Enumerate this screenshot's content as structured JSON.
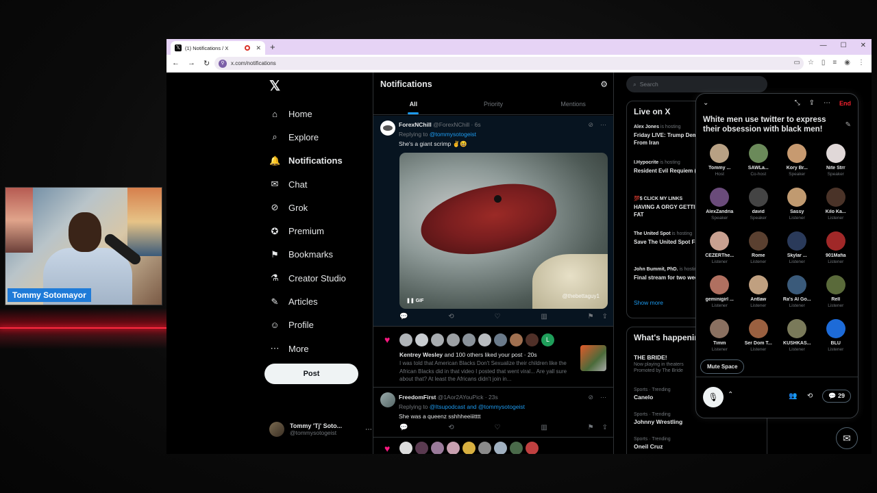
{
  "stream": {
    "caller_name": "Tommy Sotomayor"
  },
  "browser": {
    "tab_title": "(1) Notifications / X",
    "url": "x.com/notifications"
  },
  "nav": {
    "items": [
      {
        "label": "Home",
        "icon": "home-icon"
      },
      {
        "label": "Explore",
        "icon": "search-icon"
      },
      {
        "label": "Notifications",
        "icon": "bell-icon",
        "active": true
      },
      {
        "label": "Chat",
        "icon": "mail-icon"
      },
      {
        "label": "Grok",
        "icon": "grok-icon"
      },
      {
        "label": "Premium",
        "icon": "verified-icon"
      },
      {
        "label": "Bookmarks",
        "icon": "bookmark-icon"
      },
      {
        "label": "Creator Studio",
        "icon": "flask-icon"
      },
      {
        "label": "Articles",
        "icon": "article-icon"
      },
      {
        "label": "Profile",
        "icon": "person-icon"
      },
      {
        "label": "More",
        "icon": "more-circle-icon"
      }
    ],
    "post_label": "Post",
    "account_name": "Tommy 'Tj' Soto...",
    "account_handle": "@tommysotogeist"
  },
  "notifications": {
    "title": "Notifications",
    "tabs": [
      "All",
      "Priority",
      "Mentions"
    ],
    "item1": {
      "name": "ForexNChill",
      "handle": "@ForexNChill · 6s",
      "replying_prefix": "Replying to ",
      "replying_to": "@tommysotogeist",
      "text": "She's a giant scrimp ✌️😆",
      "gif_label": "GIF",
      "gif_watermark": "@thebettaguy1"
    },
    "likes": {
      "text_name": "Kentrey Wesley",
      "text_rest": " and 100 others liked your post · 20s",
      "excerpt": "I was told that American Blacks Don't Sexualize their children like the African Blacks did in that video I posted that went viral... Are yall sure about that? At least the Africans didn't join in..."
    },
    "item2": {
      "name": "FreedomFirst",
      "handle": "@1Aor2AYouPick · 23s",
      "replying_prefix": "Replying to ",
      "replying_to": "@Itsupodcast and @tommysotogeist",
      "text": "She was a queenz sshhheeiiitttt"
    }
  },
  "right": {
    "search_placeholder": "Search",
    "live_title": "Live on X",
    "live": [
      {
        "host": "Alex Jones",
        "status": "is hosting",
        "title": "Friday LIVE: Trump Demands Total Surrender From Iran"
      },
      {
        "host": "I.Hypocrite",
        "status": "is hosting",
        "title": "Resident Evil Requiem (Lucid Dream)"
      },
      {
        "host": "💯$ CLICK MY LINKS",
        "status": "",
        "title": "HAVING A ORGY GETTING TRAIN RAN ON MY FAT"
      },
      {
        "host": "The United Spot",
        "status": "is hosting",
        "title": "Save The United Spot From Closing Permanently"
      },
      {
        "host": "John Bummit, PhD.",
        "status": "is hosting",
        "title": "Final stream for two weeks (thank god) ft. ..."
      }
    ],
    "show_more": "Show more",
    "happening_title": "What's happening",
    "trends": [
      {
        "cat": "",
        "name": "THE BRIDE!",
        "promo": "Now playing in theaters",
        "promo2": "Promoted by The Bride"
      },
      {
        "cat": "Sports · Trending",
        "name": "Canelo"
      },
      {
        "cat": "Sports · Trending",
        "name": "Johnny Wrestling"
      },
      {
        "cat": "Sports · Trending",
        "name": "Oneil Cruz"
      }
    ]
  },
  "space": {
    "end_label": "End",
    "title": "White men use twitter to express their obsession with black men!",
    "participants": [
      {
        "name": "Tommy ...",
        "role": "Host",
        "color": "#b8a184"
      },
      {
        "name": "SAWLa...",
        "role": "Co-host",
        "color": "#6b8a5a"
      },
      {
        "name": "Kory Br...",
        "role": "Speaker",
        "color": "#c79a70"
      },
      {
        "name": "Nite Strr",
        "role": "Speaker",
        "color": "#e0d8d8"
      },
      {
        "name": "AlexZandria",
        "role": "Speaker",
        "color": "#6a4b7a"
      },
      {
        "name": "david",
        "role": "Speaker",
        "color": "#444444"
      },
      {
        "name": "Sassy",
        "role": "Listener",
        "color": "#c09a70"
      },
      {
        "name": "Kilo Ka...",
        "role": "Listener",
        "color": "#4a3328"
      },
      {
        "name": "CEZERThe...",
        "role": "Listener",
        "color": "#c8a090"
      },
      {
        "name": "Rome",
        "role": "Listener",
        "color": "#5a4030"
      },
      {
        "name": "Skylar ...",
        "role": "Listener",
        "color": "#2a3a5a"
      },
      {
        "name": "901Mafia",
        "role": "Listener",
        "color": "#a02828"
      },
      {
        "name": "geminigirl ...",
        "role": "Listener",
        "color": "#b07060"
      },
      {
        "name": "Antlaw",
        "role": "Listener",
        "color": "#c0a080"
      },
      {
        "name": "Ra's Al Go...",
        "role": "Listener",
        "color": "#3a5a7a"
      },
      {
        "name": "Rell",
        "role": "Listener",
        "color": "#5a6a3a"
      },
      {
        "name": "Timm",
        "role": "Listener",
        "color": "#8a7060"
      },
      {
        "name": "Ser Dom T...",
        "role": "Listener",
        "color": "#9a6040"
      },
      {
        "name": "KUSHKAS...",
        "role": "Listener",
        "color": "#7a7a5a"
      },
      {
        "name": "BLU",
        "role": "Listener",
        "color": "#1d6bd8"
      }
    ],
    "mute_label": "Mute Space",
    "listener_count": "29"
  }
}
